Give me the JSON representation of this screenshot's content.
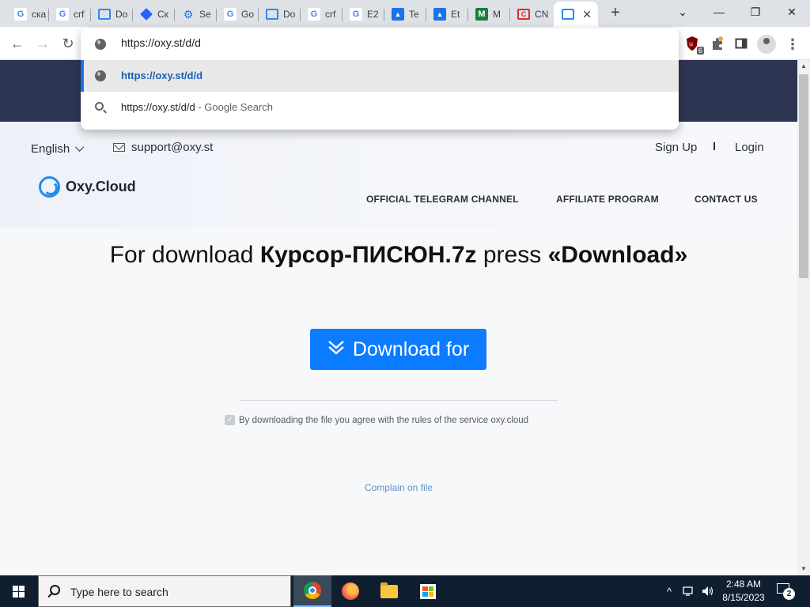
{
  "browser": {
    "tabs": [
      {
        "label": "ска",
        "favicon": "google-icon"
      },
      {
        "label": "crf",
        "favicon": "google-icon"
      },
      {
        "label": "Do",
        "favicon": "oxy-cloud-icon"
      },
      {
        "label": "Ск",
        "favicon": "blue-diamond-icon"
      },
      {
        "label": "Se",
        "favicon": "gear-icon"
      },
      {
        "label": "Go",
        "favicon": "google-icon"
      },
      {
        "label": "Do",
        "favicon": "oxy-cloud-icon"
      },
      {
        "label": "crf",
        "favicon": "google-icon"
      },
      {
        "label": "E2",
        "favicon": "google-icon"
      },
      {
        "label": "Te",
        "favicon": "triangle-app-icon"
      },
      {
        "label": "Et",
        "favicon": "triangle-app-icon"
      },
      {
        "label": "M",
        "favicon": "green-m-icon"
      },
      {
        "label": "CN",
        "favicon": "red-c-icon"
      },
      {
        "label": "",
        "favicon": "oxy-cloud-icon",
        "active": true
      }
    ],
    "new_tab_symbol": "+",
    "window_controls": {
      "tab_search": "⌄",
      "minimize": "—",
      "restore": "❐",
      "close": "✕"
    },
    "extension_badge": "6",
    "omnibox": {
      "input_value": "https://oxy.st/d/d",
      "suggestions": [
        {
          "text": "https://oxy.st/d/d",
          "suffix": "",
          "type": "url",
          "selected": true
        },
        {
          "text": "https://oxy.st/d/d",
          "suffix": "- Google Search",
          "type": "search",
          "selected": false
        }
      ]
    }
  },
  "site": {
    "language": "English",
    "support_email": "support@oxy.st",
    "sign_up": "Sign Up",
    "separator": "I",
    "login": "Login",
    "logo_text": "Oxy.Cloud",
    "nav": [
      "OFFICIAL TELEGRAM CHANNEL",
      "AFFILIATE PROGRAM",
      "CONTACT US"
    ],
    "headline": {
      "prefix": "For download",
      "filename": "Курсор-ПИСЮН.7z",
      "middle": "press",
      "action": "«Download»"
    },
    "download_button": "Download for",
    "agreement_text": "By downloading the file you agree with the rules of the service oxy.cloud",
    "complain_link": "Complain on file"
  },
  "taskbar": {
    "search_placeholder": "Type here to search",
    "time": "2:48 AM",
    "date": "8/15/2023",
    "notification_count": "2",
    "tray_chevron": "^"
  },
  "colors": {
    "accent_button": "#0b7cff",
    "banner": "#2d3553",
    "taskbar": "#101f2f",
    "link": "#5f8fc9"
  }
}
